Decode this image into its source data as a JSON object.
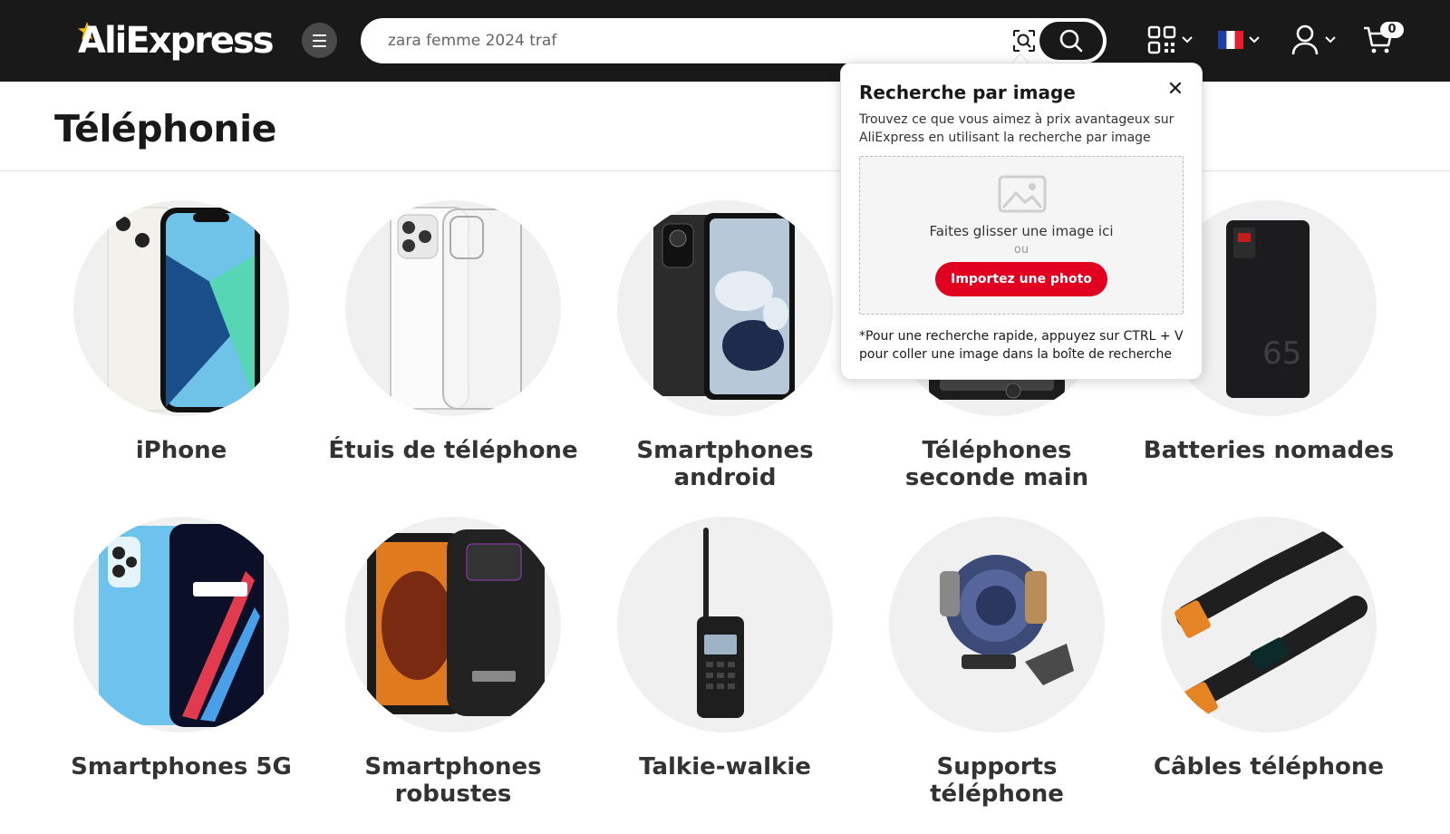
{
  "header": {
    "logo_text": "AliExpress",
    "search": {
      "value": "",
      "placeholder": "zara femme 2024 traf"
    },
    "cart_count": "0",
    "colors": {
      "bg": "#191919",
      "accent": "#e1001f",
      "logo_star": "#f7b500"
    }
  },
  "page": {
    "title": "Téléphonie"
  },
  "categories": [
    {
      "label": "iPhone",
      "icon": "iphone-image"
    },
    {
      "label": "Étuis de téléphone",
      "icon": "clear-case-image"
    },
    {
      "label": "Smartphones android",
      "icon": "android-phone-image"
    },
    {
      "label": "Téléphones seconde main",
      "icon": "used-phone-image"
    },
    {
      "label": "Batteries nomades",
      "icon": "power-bank-image"
    },
    {
      "label": "Smartphones 5G",
      "icon": "5g-phone-image"
    },
    {
      "label": "Smartphones robustes",
      "icon": "rugged-phone-image"
    },
    {
      "label": "Talkie-walkie",
      "icon": "walkie-talkie-image"
    },
    {
      "label": "Supports téléphone",
      "icon": "car-phone-holder-image"
    },
    {
      "label": "Câbles téléphone",
      "icon": "usb-c-cable-image"
    }
  ],
  "image_search_popup": {
    "title": "Recherche par image",
    "description": "Trouvez ce que vous aimez à prix avantageux sur AliExpress en utilisant la recherche par image",
    "drop_text": "Faites glisser une image ici",
    "or_text": "ou",
    "upload_label": "Importez une photo",
    "tip": "*Pour une recherche rapide, appuyez sur CTRL + V pour coller une image dans la boîte de recherche"
  }
}
